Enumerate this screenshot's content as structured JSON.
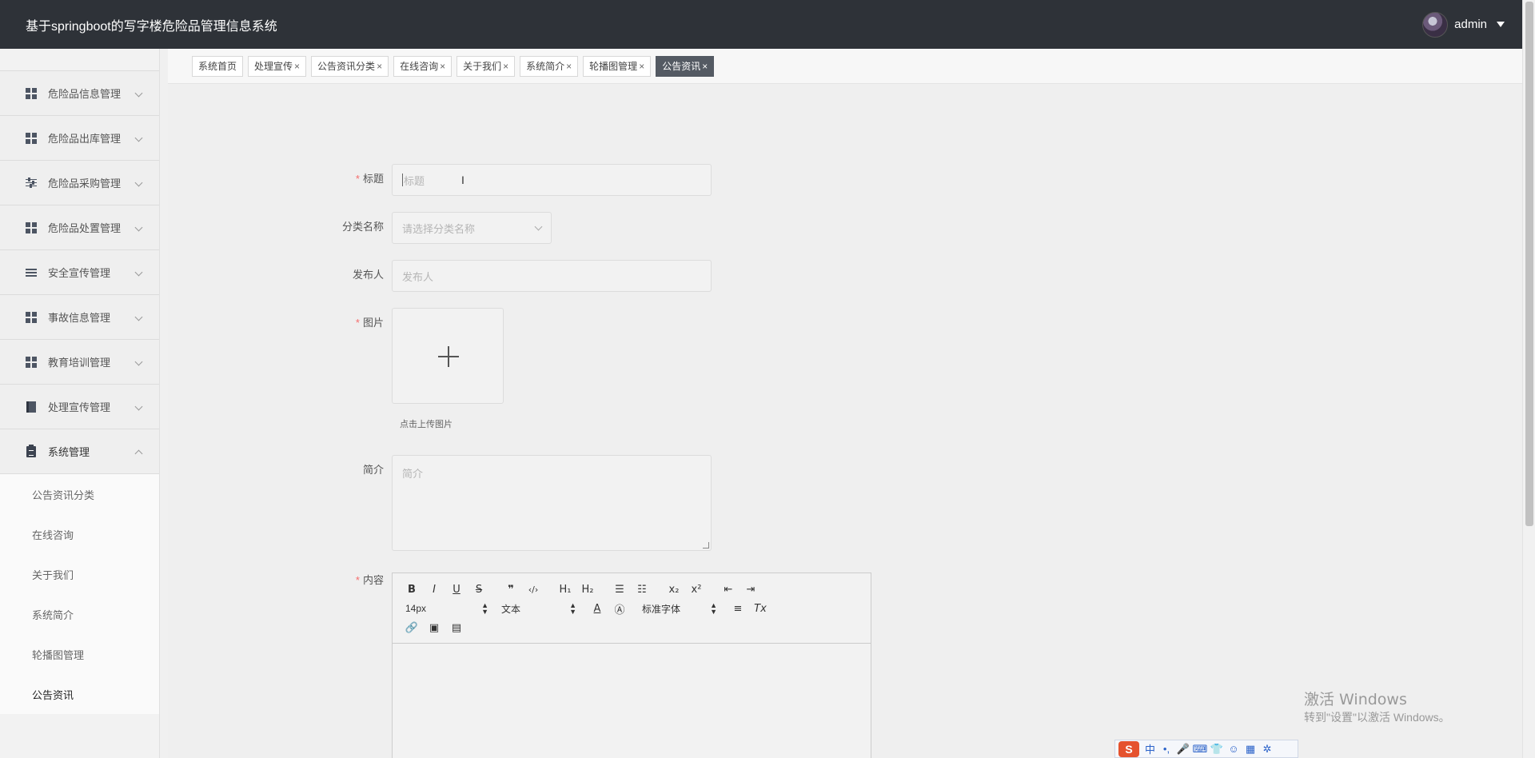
{
  "app": {
    "title": "基于springboot的写字楼危险品管理信息系统"
  },
  "user": {
    "name": "admin"
  },
  "sidebar": {
    "items": [
      {
        "label": "危险品信息管理",
        "icon": "grid-icon"
      },
      {
        "label": "危险品出库管理",
        "icon": "grid-icon"
      },
      {
        "label": "危险品采购管理",
        "icon": "sliders-icon"
      },
      {
        "label": "危险品处置管理",
        "icon": "grid-icon"
      },
      {
        "label": "安全宣传管理",
        "icon": "list-icon"
      },
      {
        "label": "事故信息管理",
        "icon": "grid-icon"
      },
      {
        "label": "教育培训管理",
        "icon": "grid-icon"
      },
      {
        "label": "处理宣传管理",
        "icon": "book-icon"
      },
      {
        "label": "系统管理",
        "icon": "clipboard-icon"
      }
    ],
    "submenu": [
      "公告资讯分类",
      "在线咨询",
      "关于我们",
      "系统简介",
      "轮播图管理",
      "公告资讯"
    ]
  },
  "tabs": [
    {
      "label": "系统首页",
      "closable": false
    },
    {
      "label": "处理宣传",
      "closable": true
    },
    {
      "label": "公告资讯分类",
      "closable": true
    },
    {
      "label": "在线咨询",
      "closable": true
    },
    {
      "label": "关于我们",
      "closable": true
    },
    {
      "label": "系统简介",
      "closable": true
    },
    {
      "label": "轮播图管理",
      "closable": true
    },
    {
      "label": "公告资讯",
      "closable": true,
      "active": true
    }
  ],
  "form": {
    "title": {
      "label": "标题",
      "placeholder": "标题",
      "required": true
    },
    "category": {
      "label": "分类名称",
      "placeholder": "请选择分类名称"
    },
    "publisher": {
      "label": "发布人",
      "placeholder": "发布人"
    },
    "image": {
      "label": "图片",
      "hint": "点击上传图片",
      "required": true
    },
    "intro": {
      "label": "简介",
      "placeholder": "简介"
    },
    "content": {
      "label": "内容",
      "required": true
    }
  },
  "editor": {
    "font_size": "14px",
    "block_type": "文本",
    "font_family": "标准字体"
  },
  "watermark": {
    "line1": "激活 Windows",
    "line2": "转到\"设置\"以激活 Windows。"
  },
  "ime": {
    "mode": "中"
  },
  "colors": {
    "header_bg": "#2e3238",
    "active_tab": "#545a63",
    "required": "#f56c6c"
  }
}
